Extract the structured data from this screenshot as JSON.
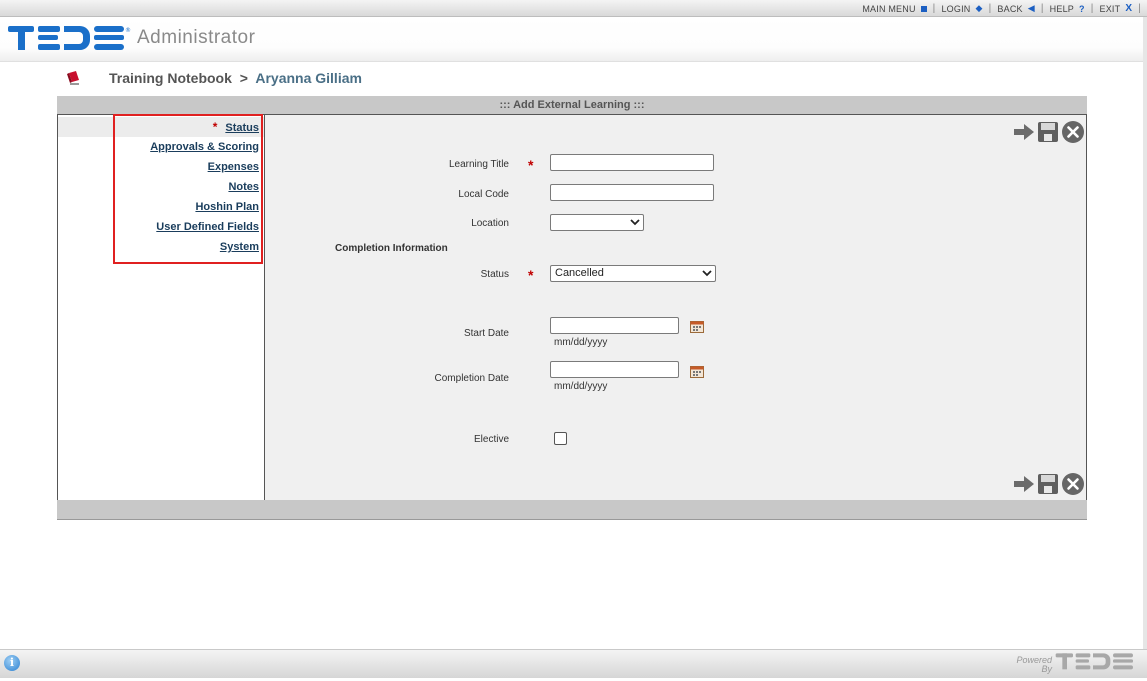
{
  "topnav": {
    "main_menu": "MAIN MENU",
    "login": "LOGIN",
    "back": "BACK",
    "help": "HELP",
    "help_icon": "?",
    "exit": "EXIT",
    "exit_icon": "X",
    "separator": "|"
  },
  "header": {
    "logo_text": "TEDS",
    "app_name": "Administrator"
  },
  "breadcrumb": {
    "section": "Training Notebook",
    "separator": ">",
    "person": "Aryanna Gilliam"
  },
  "panel": {
    "title": "::: Add External Learning :::"
  },
  "sidebar": {
    "items": [
      {
        "label": "Status",
        "required": "*"
      },
      {
        "label": "Approvals & Scoring"
      },
      {
        "label": "Expenses"
      },
      {
        "label": "Notes"
      },
      {
        "label": "Hoshin Plan"
      },
      {
        "label": "User Defined Fields"
      },
      {
        "label": "System"
      }
    ]
  },
  "form": {
    "learning_title_label": "Learning Title",
    "learning_title_value": "",
    "local_code_label": "Local Code",
    "local_code_value": "",
    "location_label": "Location",
    "location_value": "",
    "completion_section": "Completion Information",
    "status_label": "Status",
    "status_value": "Cancelled",
    "start_date_label": "Start Date",
    "start_date_value": "",
    "start_date_hint": "mm/dd/yyyy",
    "completion_date_label": "Completion Date",
    "completion_date_value": "",
    "completion_date_hint": "mm/dd/yyyy",
    "elective_label": "Elective",
    "required_mark": "*"
  },
  "footer": {
    "info_icon": "i",
    "powered_line1": "Powered",
    "powered_line2": "By"
  },
  "colors": {
    "accent_blue": "#1c5fc2",
    "required_red": "#c00000",
    "highlight_red": "#e02020",
    "link_navy": "#1a3d5c"
  },
  "icons": [
    "next-arrow-icon",
    "save-disk-icon",
    "close-circle-icon",
    "calendar-icon",
    "book-icon",
    "info-icon"
  ]
}
